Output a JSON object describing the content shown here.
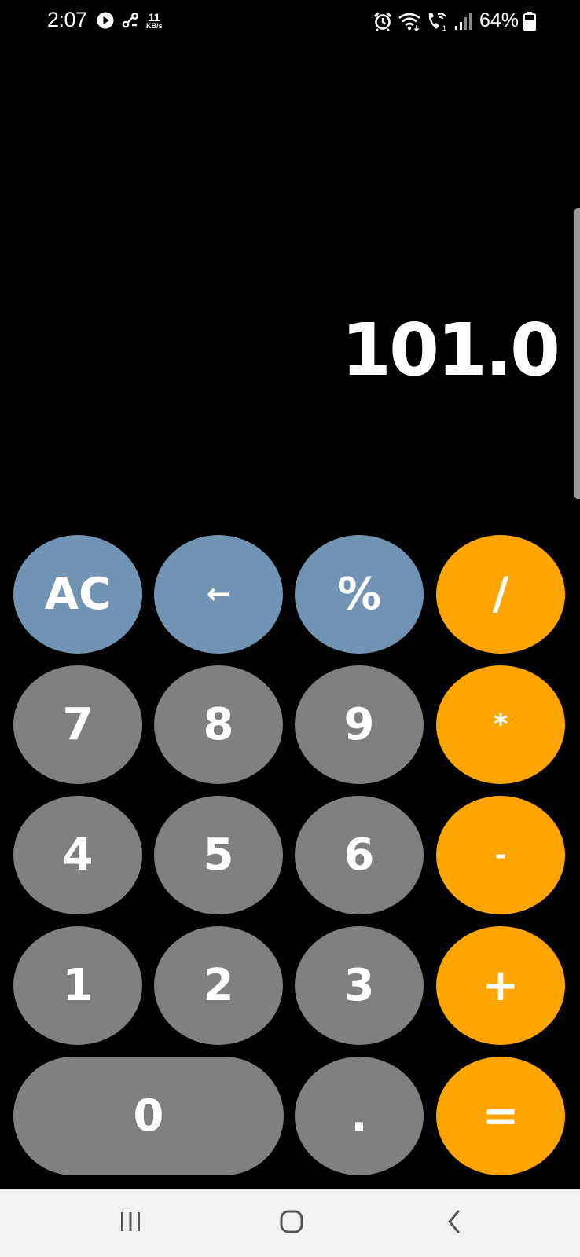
{
  "status_bar": {
    "time": "2:07",
    "net_speed_value": "11",
    "net_speed_unit": "KB/s",
    "battery_percent": "64%",
    "icons": [
      "media-play-icon",
      "link-icon",
      "alarm-icon",
      "wifi-icon",
      "wifi-calling-icon",
      "signal-icon",
      "battery-icon"
    ]
  },
  "display": {
    "value": "101.0"
  },
  "keypad": {
    "row1": [
      "AC",
      "←",
      "%",
      "/"
    ],
    "row2": [
      "7",
      "8",
      "9",
      "*"
    ],
    "row3": [
      "4",
      "5",
      "6",
      "-"
    ],
    "row4": [
      "1",
      "2",
      "3",
      "+"
    ],
    "row5": [
      "0",
      ".",
      "="
    ]
  },
  "nav_bar": {
    "icons": [
      "recents-icon",
      "home-icon",
      "back-icon"
    ]
  },
  "colors": {
    "background": "#000000",
    "function_key": "#7194b4",
    "number_key": "#808080",
    "operator_key": "#fea500",
    "nav_bar": "#f2f2f2"
  }
}
